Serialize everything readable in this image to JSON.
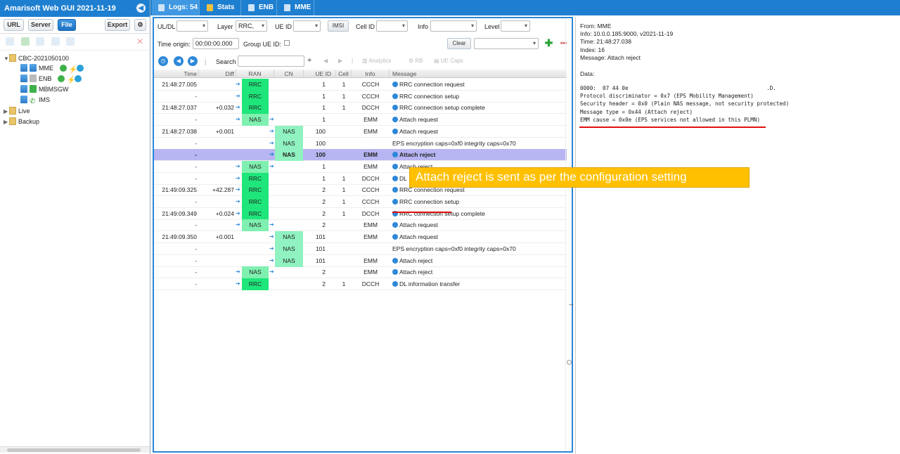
{
  "app": {
    "title": "Amarisoft Web GUI 2021-11-19"
  },
  "left_toolbar": {
    "url": "URL",
    "server": "Server",
    "file": "File",
    "export": "Export"
  },
  "tree": {
    "root": "CBC-2021050100",
    "children": [
      "MME",
      "ENB",
      "MBMSGW",
      "IMS"
    ],
    "live": "Live",
    "backup": "Backup"
  },
  "tabs": [
    {
      "label": "Logs: 54"
    },
    {
      "label": "Stats"
    },
    {
      "label": "ENB"
    },
    {
      "label": "MME"
    }
  ],
  "filters": {
    "uldl_label": "UL/DL",
    "layer_label": "Layer",
    "layer_value": "RRC,",
    "ueid_label": "UE ID",
    "imsi_button": "IMSI",
    "cellid_label": "Cell ID",
    "info_label": "Info",
    "level_label": "Level",
    "time_origin_label": "Time origin:",
    "time_origin_value": "00:00:00.000",
    "group_ueid_label": "Group UE ID:",
    "clear_button": "Clear",
    "search_label": "Search",
    "analytics_label": "Analytics",
    "rb_label": "RB",
    "ue_caps_label": "UE Caps"
  },
  "columns": [
    "Time",
    "Diff",
    "RAN",
    "CN",
    "UE ID",
    "Cell",
    "Info",
    "Message"
  ],
  "rows": [
    {
      "time": "21:48:27.005",
      "diff": "",
      "ran": "RRC",
      "cn": "",
      "ueid": "1",
      "cell": "1",
      "info": "CCCH",
      "msg": "RRC connection request",
      "icon": true
    },
    {
      "time": "-",
      "diff": "",
      "ran": "RRC",
      "cn": "",
      "ueid": "1",
      "cell": "1",
      "info": "CCCH",
      "msg": "RRC connection setup",
      "icon": true
    },
    {
      "time": "21:48:27.037",
      "diff": "+0.032",
      "ran": "RRC",
      "cn": "",
      "ueid": "1",
      "cell": "1",
      "info": "DCCH",
      "msg": "RRC connection setup complete",
      "icon": true
    },
    {
      "time": "-",
      "diff": "",
      "ran": "NAS",
      "cn": "",
      "ueid": "1",
      "cell": "",
      "info": "EMM",
      "msg": "Attach request",
      "icon": true
    },
    {
      "time": "21:48:27.038",
      "diff": "+0.001",
      "ran": "",
      "cn": "NAS",
      "ueid": "100",
      "cell": "",
      "info": "EMM",
      "msg": "Attach request",
      "icon": true
    },
    {
      "time": "-",
      "diff": "",
      "ran": "",
      "cn": "NAS",
      "ueid": "100",
      "cell": "",
      "info": "",
      "msg": "EPS encryption caps=0xf0 integrity caps=0x70",
      "icon": false
    },
    {
      "time": "-",
      "diff": "",
      "ran": "",
      "cn": "NAS",
      "ueid": "100",
      "cell": "",
      "info": "EMM",
      "msg": "Attach reject",
      "icon": true,
      "selected": true
    },
    {
      "time": "-",
      "diff": "",
      "ran": "NAS",
      "cn": "",
      "ueid": "1",
      "cell": "",
      "info": "EMM",
      "msg": "Attach reject",
      "icon": true
    },
    {
      "time": "-",
      "diff": "",
      "ran": "RRC",
      "cn": "",
      "ueid": "1",
      "cell": "1",
      "info": "DCCH",
      "msg": "DL",
      "icon": true
    },
    {
      "time": "21:49:09.325",
      "diff": "+42.287",
      "ran": "RRC",
      "cn": "",
      "ueid": "2",
      "cell": "1",
      "info": "CCCH",
      "msg": "RRC connection request",
      "icon": true
    },
    {
      "time": "-",
      "diff": "",
      "ran": "RRC",
      "cn": "",
      "ueid": "2",
      "cell": "1",
      "info": "CCCH",
      "msg": "RRC connection setup",
      "icon": true
    },
    {
      "time": "21:49:09.349",
      "diff": "+0.024",
      "ran": "RRC",
      "cn": "",
      "ueid": "2",
      "cell": "1",
      "info": "DCCH",
      "msg": "RRC connection setup complete",
      "icon": true
    },
    {
      "time": "-",
      "diff": "",
      "ran": "NAS",
      "cn": "",
      "ueid": "2",
      "cell": "",
      "info": "EMM",
      "msg": "Attach request",
      "icon": true
    },
    {
      "time": "21:49:09.350",
      "diff": "+0.001",
      "ran": "",
      "cn": "NAS",
      "ueid": "101",
      "cell": "",
      "info": "EMM",
      "msg": "Attach request",
      "icon": true
    },
    {
      "time": "-",
      "diff": "",
      "ran": "",
      "cn": "NAS",
      "ueid": "101",
      "cell": "",
      "info": "",
      "msg": "EPS encryption caps=0xf0 integrity caps=0x70",
      "icon": false
    },
    {
      "time": "-",
      "diff": "",
      "ran": "",
      "cn": "NAS",
      "ueid": "101",
      "cell": "",
      "info": "EMM",
      "msg": "Attach reject",
      "icon": true
    },
    {
      "time": "-",
      "diff": "",
      "ran": "NAS",
      "cn": "",
      "ueid": "2",
      "cell": "",
      "info": "EMM",
      "msg": "Attach reject",
      "icon": true
    },
    {
      "time": "-",
      "diff": "",
      "ran": "RRC",
      "cn": "",
      "ueid": "2",
      "cell": "1",
      "info": "DCCH",
      "msg": "DL information transfer",
      "icon": true
    }
  ],
  "detail": {
    "from": "From: MME",
    "info": "Info: 10.0.0.185:9000, v2021-11-19",
    "time": "Time: 21:48:27.038",
    "index": "Index: 16",
    "message": "Message: Attach reject",
    "data_label": "Data:",
    "hex_line": "0000:  07 44 0e                                           .D.",
    "decode": [
      "Protocol discriminator = 0x7 (EPS Mobility Management)",
      "Security header = 0x0 (Plain NAS message, not security protected)",
      "Message type = 0x44 (Attach reject)",
      "EMM cause = 0x0e (EPS services not allowed in this PLMN)"
    ]
  },
  "callout": "Attach reject is sent as per the configuration setting"
}
